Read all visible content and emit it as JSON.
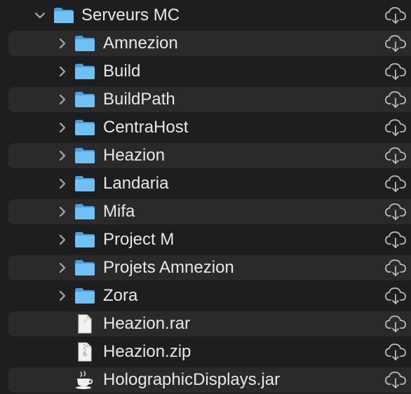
{
  "root": {
    "name": "Serveurs MC",
    "expanded": true,
    "status_icon": "cloud-download-icon",
    "items": [
      {
        "name": "Amnezion",
        "kind": "folder",
        "icon": "folder-icon"
      },
      {
        "name": "Build",
        "kind": "folder",
        "icon": "folder-icon"
      },
      {
        "name": "BuildPath",
        "kind": "folder",
        "icon": "folder-icon"
      },
      {
        "name": "CentraHost",
        "kind": "folder",
        "icon": "folder-icon"
      },
      {
        "name": "Heazion",
        "kind": "folder",
        "icon": "folder-icon"
      },
      {
        "name": "Landaria",
        "kind": "folder",
        "icon": "folder-icon"
      },
      {
        "name": "Mifa",
        "kind": "folder",
        "icon": "folder-icon"
      },
      {
        "name": "Project M",
        "kind": "folder",
        "icon": "folder-icon"
      },
      {
        "name": "Projets Amnezion",
        "kind": "folder",
        "icon": "folder-icon"
      },
      {
        "name": "Zora",
        "kind": "folder",
        "icon": "folder-icon"
      },
      {
        "name": "Heazion.rar",
        "kind": "rar",
        "icon": "rar-file-icon"
      },
      {
        "name": "Heazion.zip",
        "kind": "zip",
        "icon": "zip-file-icon"
      },
      {
        "name": "HolographicDisplays.jar",
        "kind": "jar",
        "icon": "java-coffee-icon"
      }
    ]
  },
  "colors": {
    "background": "#1e1e1e",
    "alt_row": "#2a2a2a",
    "folder": "#5eb3ee",
    "text": "#e8e8e8",
    "chevron": "#a9a9a9",
    "cloud": "#b9b9b9"
  }
}
